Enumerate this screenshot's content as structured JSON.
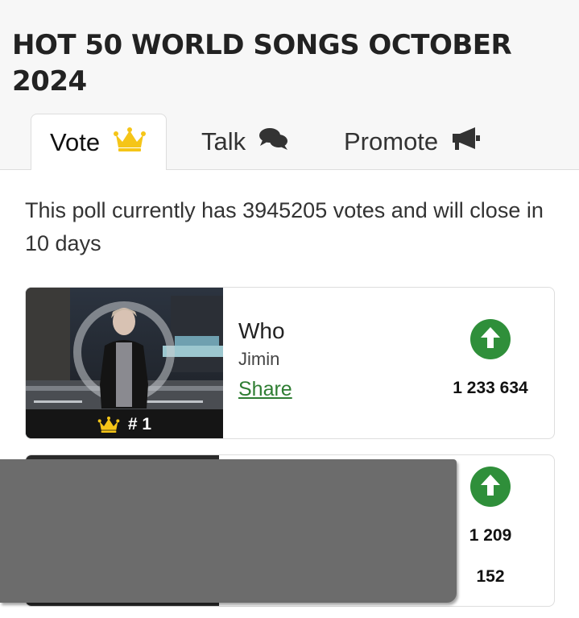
{
  "page": {
    "title": "HOT 50 WORLD SONGS OCTOBER 2024"
  },
  "tabs": [
    {
      "label": "Vote",
      "icon": "crown-icon",
      "active": true
    },
    {
      "label": "Talk",
      "icon": "chat-bubbles-icon",
      "active": false
    },
    {
      "label": "Promote",
      "icon": "megaphone-icon",
      "active": false
    }
  ],
  "poll": {
    "info": "This poll currently has 3945205 votes and will close in 10 days"
  },
  "entries": [
    {
      "rank": "# 1",
      "title": "Who",
      "artist": "Jimin",
      "share_label": "Share",
      "votes": "1 233 634"
    },
    {
      "votes_line1": "1 209",
      "votes_line2": "152"
    }
  ],
  "colors": {
    "accent_green": "#2f8f3a",
    "crown_gold": "#f5c518",
    "overlay_gray": "#6c6c6c"
  }
}
